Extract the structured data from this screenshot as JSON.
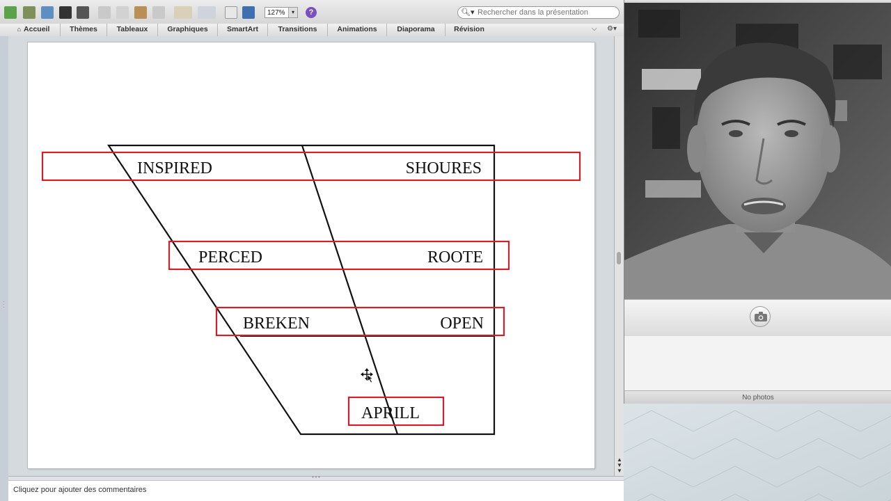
{
  "powerpoint": {
    "zoom": "127%",
    "search_placeholder": "Rechercher dans la présentation",
    "ribbon_tabs": [
      "Accueil",
      "Thèmes",
      "Tableaux",
      "Graphiques",
      "SmartArt",
      "Transitions",
      "Animations",
      "Diaporama",
      "Révision"
    ],
    "slide_words": {
      "inspired": "INSPIRED",
      "shoures": "SHOURES",
      "perced": "PERCED",
      "roote": "ROOTE",
      "breken": "BREKEN",
      "open": "OPEN",
      "aprill": "APRILL"
    },
    "notes_placeholder": "Cliquez pour ajouter des commentaires"
  },
  "photobooth": {
    "status": "No photos"
  },
  "colors": {
    "highlight_box": "#d0202a",
    "help_button": "#7b4fc4"
  }
}
